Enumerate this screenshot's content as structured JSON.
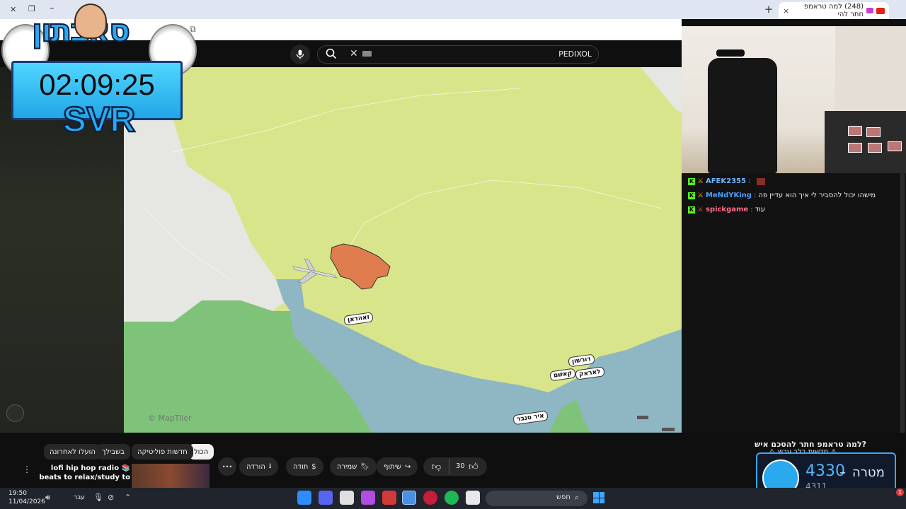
{
  "browser": {
    "tab_title": "(248) למה טראמפ חתר להי",
    "new_tab_symbol": "+",
    "tab_close_symbol": "×"
  },
  "youtube": {
    "search_query": "PEDIXOL",
    "clear_symbol": "✕",
    "filter_chips": [
      "הכול",
      "חדשות פוליטיקה",
      "בשבילך",
      "הועלו לאחרונה"
    ],
    "actions": {
      "likes": "30",
      "share": "שיתוף",
      "save": "שמירה",
      "thanks": "תודה",
      "download": "הורדה",
      "more": "•••"
    },
    "recommended": {
      "title": "lofi hip hop radio 📚 beats to relax/study to",
      "more": "⋮"
    },
    "video_title_peek": "למה טראמפ חתר להסכם איש?",
    "map_attribution": "© MapTiler",
    "map_labels": [
      "זאהדאן",
      "דורשון",
      "קאשם",
      "לאראק",
      "איר סנבר"
    ]
  },
  "stream_overlay": {
    "logo": "סאבתון",
    "timer": "02:09:25",
    "tag": "SVR",
    "goal_label": "מטרה",
    "goal_dash": "–",
    "goal_target": "4330",
    "goal_current": "4311",
    "goal_peek": "⚠ חדשות בלב ערוץ ⚠"
  },
  "chat": {
    "messages": [
      {
        "user": "AFEK2355",
        "text": "",
        "color": "#6fb5ff"
      },
      {
        "user": "MeNdYKing",
        "text": "מישהו יכול להסביר לי איך הוא עדיין פה",
        "color": "#4fa0ff"
      },
      {
        "user": "spickgame",
        "text": "עוד",
        "color": "#ff6b8a"
      }
    ],
    "separator": ":"
  },
  "taskbar": {
    "time": "19:50",
    "date": "11/04/2026",
    "language": "עבר",
    "search_label": "חפש",
    "notification_count": "1"
  },
  "colors": {
    "map_land": "#d9e58a",
    "map_sea": "#8fb6c3",
    "map_green": "#7fc27a",
    "map_grey": "#e6e6e3",
    "region_highlight": "#e07d4e",
    "accent": "#2aa9ef"
  }
}
